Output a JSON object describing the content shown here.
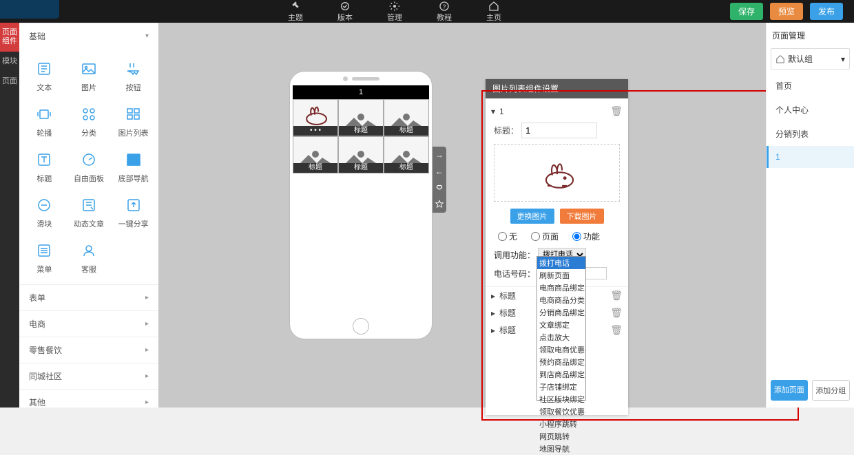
{
  "topnav": [
    {
      "label": "主题",
      "icon": "theme"
    },
    {
      "label": "版本",
      "icon": "version"
    },
    {
      "label": "管理",
      "icon": "manage"
    },
    {
      "label": "教程",
      "icon": "tutorial"
    },
    {
      "label": "主页",
      "icon": "home"
    }
  ],
  "topbtns": {
    "save": "保存",
    "preview": "预览",
    "publish": "发布"
  },
  "leftrail": [
    {
      "label": "页面\n组件",
      "active": true
    },
    {
      "label": "模块",
      "active": false
    },
    {
      "label": "页面",
      "active": false
    }
  ],
  "comp_panel": {
    "section_basic": "基础",
    "items": [
      {
        "label": "文本",
        "icon": "text"
      },
      {
        "label": "图片",
        "icon": "image"
      },
      {
        "label": "按钮",
        "icon": "button"
      },
      {
        "label": "轮播",
        "icon": "carousel"
      },
      {
        "label": "分类",
        "icon": "category"
      },
      {
        "label": "图片列表",
        "icon": "imglist"
      },
      {
        "label": "标题",
        "icon": "title"
      },
      {
        "label": "自由面板",
        "icon": "panel"
      },
      {
        "label": "底部导航",
        "icon": "bottomnav",
        "active": true
      },
      {
        "label": "滑块",
        "icon": "slider"
      },
      {
        "label": "动态文章",
        "icon": "article"
      },
      {
        "label": "一键分享",
        "icon": "share"
      },
      {
        "label": "菜单",
        "icon": "menu"
      },
      {
        "label": "客服",
        "icon": "service"
      }
    ],
    "sections_collapsed": [
      "表单",
      "电商",
      "零售餐饮",
      "同城社区",
      "其他"
    ]
  },
  "phone": {
    "title": "1",
    "cells": [
      {
        "first": true
      },
      {
        "label": "标题"
      },
      {
        "label": "标题"
      },
      {
        "label": "标题"
      },
      {
        "label": "标题"
      },
      {
        "label": "标题"
      }
    ]
  },
  "settings": {
    "header": "图片列表组件设置",
    "item_num": "1",
    "title_label": "标题：",
    "title_value": "1",
    "btn_change": "更换图片",
    "btn_download": "下载图片",
    "radio_none": "无",
    "radio_page": "页面",
    "radio_func": "功能",
    "func_label": "调用功能：",
    "func_value": "拨打电话",
    "tel_label": "电话号码：",
    "tel_value": "",
    "sub_label": "标题",
    "dropdown": [
      "拨打电话",
      "刷新页面",
      "电商商品绑定",
      "电商商品分类",
      "分销商品绑定",
      "文章绑定",
      "点击放大",
      "领取电商优惠券",
      "预约商品绑定",
      "到店商品绑定",
      "子店铺绑定",
      "社区版块绑定",
      "领取餐饮优惠券",
      "小程序跳转",
      "网页跳转",
      "地图导航"
    ]
  },
  "rpanel": {
    "header": "页面管理",
    "group": "默认组",
    "pages": [
      "首页",
      "个人中心",
      "分销列表",
      "1"
    ],
    "active": 3,
    "add_page": "添加页面",
    "add_group": "添加分组"
  }
}
